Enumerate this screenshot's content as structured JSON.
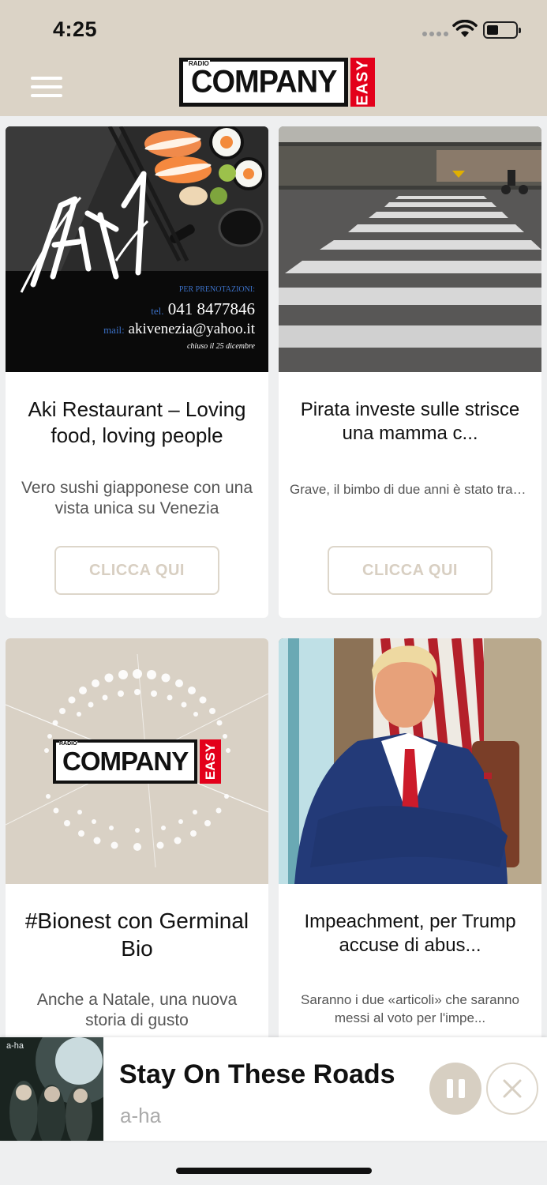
{
  "status_bar": {
    "time": "4:25"
  },
  "header": {
    "logo": {
      "radio": "RADIO",
      "company": "COMPANY",
      "easy": "EASY"
    }
  },
  "cards": [
    {
      "title": "Aki Restaurant – Loving food, loving people",
      "subtitle": "Vero sushi giapponese con una vista unica su Venezia",
      "button": "CLICCA QUI",
      "image": {
        "logo_text": "Aki",
        "booking_label": "PER PRENOTAZIONI:",
        "tel_label": "tel.",
        "tel": "041 8477846",
        "mail_label": "mail:",
        "mail": "akivenezia@yahoo.it",
        "note": "chiuso il 25 dicembre"
      }
    },
    {
      "title": "Pirata investe sulle strisce una mamma  c...",
      "subtitle": "Grave, il bimbo di due anni è stato trasferito all'ospedale di Bergam...",
      "button": "CLICCA QUI"
    },
    {
      "title": "#Bionest con Germinal Bio",
      "subtitle": "Anche a Natale, una nuova storia di gusto",
      "image": {
        "radio": "RADIO",
        "company": "COMPANY",
        "easy": "EASY"
      }
    },
    {
      "title": "Impeachment, per Trump accuse di abus...",
      "subtitle": "Saranno i due «articoli» che saranno messi al voto per l'impe..."
    }
  ],
  "player": {
    "song": "Stay On These Roads",
    "artist": "a-ha",
    "cover_text": "a-ha"
  },
  "colors": {
    "header_bg": "#dbd3c6",
    "accent": "#d7cfc2",
    "logo_red": "#e3001b",
    "page_bg": "#eeeff0"
  }
}
